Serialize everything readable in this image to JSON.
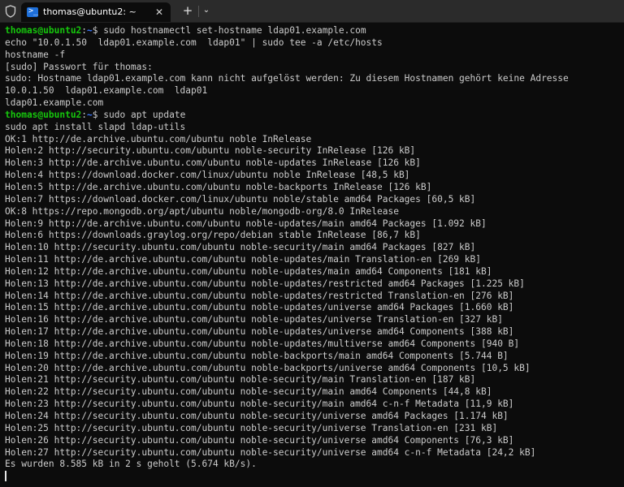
{
  "window": {
    "tab_title": "thomas@ubuntu2: ~",
    "close_glyph": "✕",
    "new_tab_glyph": "+",
    "dropdown_glyph": "⌄"
  },
  "prompt": {
    "user_host": "thomas@ubuntu2",
    "colon": ":",
    "path": "~",
    "suffix": "$ "
  },
  "terminal": {
    "cmd1": "sudo hostnamectl set-hostname ldap01.example.com",
    "lines_a": [
      "echo \"10.0.1.50  ldap01.example.com  ldap01\" | sudo tee -a /etc/hosts",
      "hostname -f",
      "[sudo] Passwort für thomas:",
      "sudo: Hostname ldap01.example.com kann nicht aufgelöst werden: Zu diesem Hostnamen gehört keine Adresse",
      "10.0.1.50  ldap01.example.com  ldap01",
      "ldap01.example.com"
    ],
    "cmd2": "sudo apt update",
    "lines_b": [
      "sudo apt install slapd ldap-utils",
      "OK:1 http://de.archive.ubuntu.com/ubuntu noble InRelease",
      "Holen:2 http://security.ubuntu.com/ubuntu noble-security InRelease [126 kB]",
      "Holen:3 http://de.archive.ubuntu.com/ubuntu noble-updates InRelease [126 kB]",
      "Holen:4 https://download.docker.com/linux/ubuntu noble InRelease [48,5 kB]",
      "Holen:5 http://de.archive.ubuntu.com/ubuntu noble-backports InRelease [126 kB]",
      "Holen:7 https://download.docker.com/linux/ubuntu noble/stable amd64 Packages [60,5 kB]",
      "OK:8 https://repo.mongodb.org/apt/ubuntu noble/mongodb-org/8.0 InRelease",
      "Holen:9 http://de.archive.ubuntu.com/ubuntu noble-updates/main amd64 Packages [1.092 kB]",
      "Holen:6 https://downloads.graylog.org/repo/debian stable InRelease [86,7 kB]",
      "Holen:10 http://security.ubuntu.com/ubuntu noble-security/main amd64 Packages [827 kB]",
      "Holen:11 http://de.archive.ubuntu.com/ubuntu noble-updates/main Translation-en [269 kB]",
      "Holen:12 http://de.archive.ubuntu.com/ubuntu noble-updates/main amd64 Components [181 kB]",
      "Holen:13 http://de.archive.ubuntu.com/ubuntu noble-updates/restricted amd64 Packages [1.225 kB]",
      "Holen:14 http://de.archive.ubuntu.com/ubuntu noble-updates/restricted Translation-en [276 kB]",
      "Holen:15 http://de.archive.ubuntu.com/ubuntu noble-updates/universe amd64 Packages [1.660 kB]",
      "Holen:16 http://de.archive.ubuntu.com/ubuntu noble-updates/universe Translation-en [327 kB]",
      "Holen:17 http://de.archive.ubuntu.com/ubuntu noble-updates/universe amd64 Components [388 kB]",
      "Holen:18 http://de.archive.ubuntu.com/ubuntu noble-updates/multiverse amd64 Components [940 B]",
      "Holen:19 http://de.archive.ubuntu.com/ubuntu noble-backports/main amd64 Components [5.744 B]",
      "Holen:20 http://de.archive.ubuntu.com/ubuntu noble-backports/universe amd64 Components [10,5 kB]",
      "Holen:21 http://security.ubuntu.com/ubuntu noble-security/main Translation-en [187 kB]",
      "Holen:22 http://security.ubuntu.com/ubuntu noble-security/main amd64 Components [44,8 kB]",
      "Holen:23 http://security.ubuntu.com/ubuntu noble-security/main amd64 c-n-f Metadata [11,9 kB]",
      "Holen:24 http://security.ubuntu.com/ubuntu noble-security/universe amd64 Packages [1.174 kB]",
      "Holen:25 http://security.ubuntu.com/ubuntu noble-security/universe Translation-en [231 kB]",
      "Holen:26 http://security.ubuntu.com/ubuntu noble-security/universe amd64 Components [76,3 kB]",
      "Holen:27 http://security.ubuntu.com/ubuntu noble-security/universe amd64 c-n-f Metadata [24,2 kB]",
      "Es wurden 8.585 kB in 2 s geholt (5.674 kB/s)."
    ]
  },
  "colors": {
    "background": "#0c0c0c",
    "text": "#cccccc",
    "prompt_user": "#16c60c",
    "prompt_path": "#3b78ff",
    "titlebar": "#2b2b2b"
  }
}
